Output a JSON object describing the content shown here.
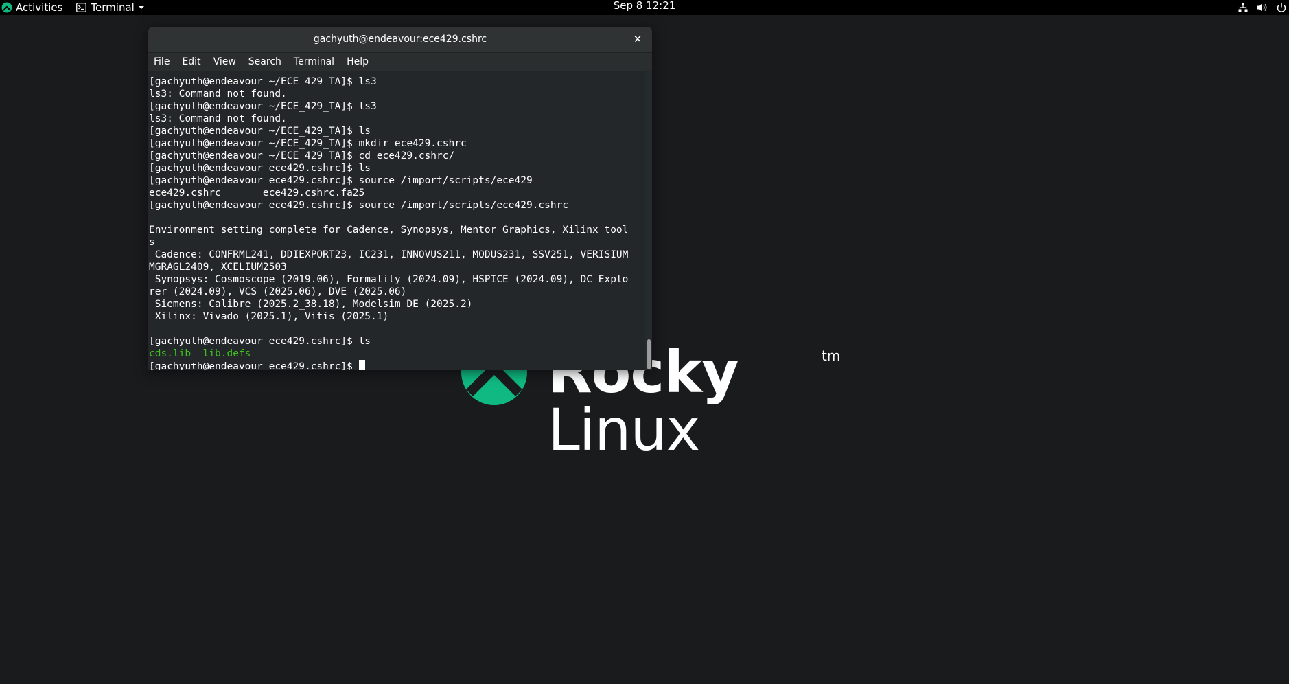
{
  "topbar": {
    "activities_label": "Activities",
    "app_menu_label": "Terminal",
    "clock": "Sep 8  12:21",
    "tray_icons": [
      "network-icon",
      "volume-icon",
      "power-icon"
    ]
  },
  "wallpaper": {
    "logo_word_1": "Rocky",
    "logo_word_2": " Linux",
    "logo_tm": "tm",
    "logo_color": "#10b981"
  },
  "window": {
    "title": "gachyuth@endeavour:ece429.cshrc",
    "close_glyph": "✕",
    "menu": [
      "File",
      "Edit",
      "View",
      "Search",
      "Terminal",
      "Help"
    ]
  },
  "terminal": {
    "lines": [
      {
        "text": "[gachyuth@endeavour ~/ECE_429_TA]$ ls3"
      },
      {
        "text": "ls3: Command not found."
      },
      {
        "text": "[gachyuth@endeavour ~/ECE_429_TA]$ ls3"
      },
      {
        "text": "ls3: Command not found."
      },
      {
        "text": "[gachyuth@endeavour ~/ECE_429_TA]$ ls"
      },
      {
        "text": "[gachyuth@endeavour ~/ECE_429_TA]$ mkdir ece429.cshrc"
      },
      {
        "text": "[gachyuth@endeavour ~/ECE_429_TA]$ cd ece429.cshrc/"
      },
      {
        "text": "[gachyuth@endeavour ece429.cshrc]$ ls"
      },
      {
        "text": "[gachyuth@endeavour ece429.cshrc]$ source /import/scripts/ece429"
      },
      {
        "text": "ece429.cshrc       ece429.cshrc.fa25"
      },
      {
        "text": "[gachyuth@endeavour ece429.cshrc]$ source /import/scripts/ece429.cshrc"
      },
      {
        "text": ""
      },
      {
        "text": "Environment setting complete for Cadence, Synopsys, Mentor Graphics, Xilinx tool"
      },
      {
        "text": "s"
      },
      {
        "text": " Cadence: CONFRML241, DDIEXPORT23, IC231, INNOVUS211, MODUS231, SSV251, VERISIUM"
      },
      {
        "text": "MGRAGL2409, XCELIUM2503"
      },
      {
        "text": " Synopsys: Cosmoscope (2019.06), Formality (2024.09), HSPICE (2024.09), DC Explo"
      },
      {
        "text": "rer (2024.09), VCS (2025.06), DVE (2025.06)"
      },
      {
        "text": " Siemens: Calibre (2025.2_38.18), Modelsim DE (2025.2)"
      },
      {
        "text": " Xilinx: Vivado (2025.1), Vitis (2025.1)"
      },
      {
        "text": ""
      },
      {
        "text": "[gachyuth@endeavour ece429.cshrc]$ ls"
      },
      {
        "text": "cds.lib  lib.defs",
        "color": "#3ec21c"
      },
      {
        "text": "[gachyuth@endeavour ece429.cshrc]$ ",
        "cursor": true
      }
    ]
  }
}
